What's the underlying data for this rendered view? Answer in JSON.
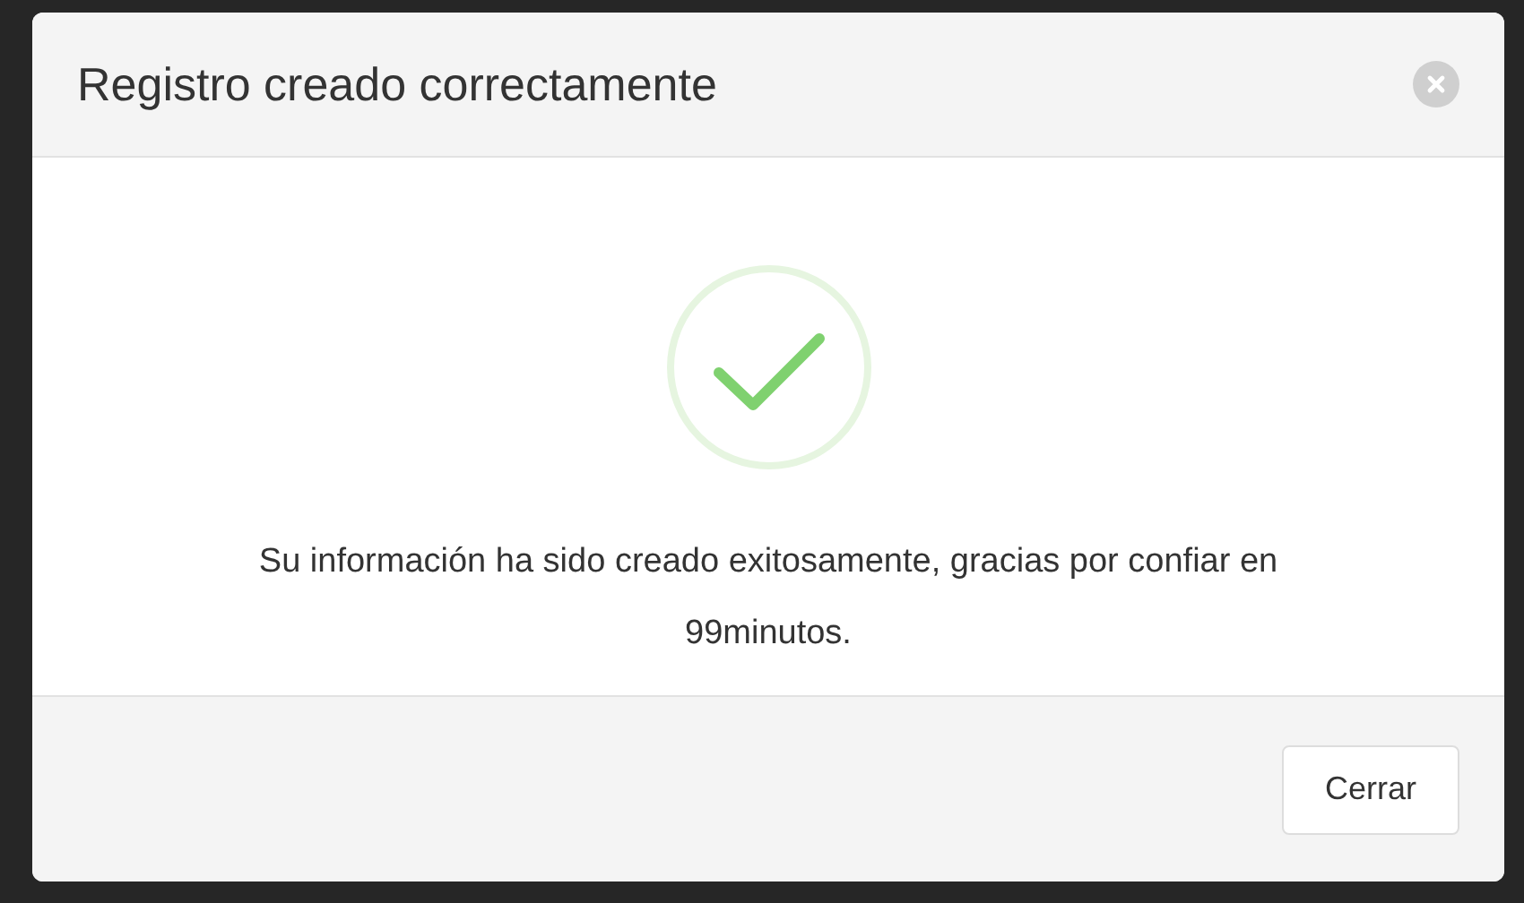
{
  "dialog": {
    "title": "Registro creado correctamente",
    "message": "Su información ha sido creado exitosamente, gracias por confiar en 99minutos.",
    "buttons": [
      {
        "label": "Cerrar"
      }
    ]
  }
}
